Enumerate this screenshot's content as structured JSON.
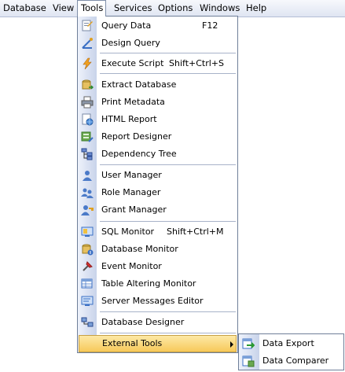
{
  "menubar": {
    "items": [
      {
        "label": "Database"
      },
      {
        "label": "View"
      },
      {
        "label": "Tools"
      },
      {
        "label": "Services"
      },
      {
        "label": "Options"
      },
      {
        "label": "Windows"
      },
      {
        "label": "Help"
      }
    ]
  },
  "tools_menu": {
    "query_data": {
      "label": "Query Data",
      "shortcut": "F12",
      "icon": "query-data-icon"
    },
    "design_query": {
      "label": "Design Query",
      "icon": "design-query-icon"
    },
    "execute_script": {
      "label": "Execute Script",
      "shortcut": "Shift+Ctrl+S",
      "icon": "execute-script-icon"
    },
    "extract_database": {
      "label": "Extract Database",
      "icon": "extract-database-icon"
    },
    "print_metadata": {
      "label": "Print Metadata",
      "icon": "printer-icon"
    },
    "html_report": {
      "label": "HTML Report",
      "icon": "html-report-icon"
    },
    "report_designer": {
      "label": "Report Designer",
      "icon": "report-designer-icon"
    },
    "dependency_tree": {
      "label": "Dependency Tree",
      "icon": "dependency-tree-icon"
    },
    "user_manager": {
      "label": "User Manager",
      "icon": "user-icon"
    },
    "role_manager": {
      "label": "Role Manager",
      "icon": "role-icon"
    },
    "grant_manager": {
      "label": "Grant Manager",
      "icon": "grant-icon"
    },
    "sql_monitor": {
      "label": "SQL Monitor",
      "shortcut": "Shift+Ctrl+M",
      "icon": "sql-monitor-icon"
    },
    "database_monitor": {
      "label": "Database Monitor",
      "icon": "database-monitor-icon"
    },
    "event_monitor": {
      "label": "Event Monitor",
      "icon": "event-monitor-icon"
    },
    "table_altering_monitor": {
      "label": "Table Altering Monitor",
      "icon": "table-altering-icon"
    },
    "server_messages_editor": {
      "label": "Server Messages Editor",
      "icon": "server-messages-icon"
    },
    "database_designer": {
      "label": "Database Designer",
      "icon": "database-designer-icon"
    },
    "external_tools": {
      "label": "External Tools"
    }
  },
  "external_tools_submenu": {
    "data_export": {
      "label": "Data Export",
      "icon": "data-export-icon"
    },
    "data_comparer": {
      "label": "Data Comparer",
      "icon": "data-comparer-icon"
    }
  },
  "colors": {
    "highlight": "#f7c95a",
    "gutter": "#c8d3ea",
    "menubar": "#dfe5f2"
  }
}
